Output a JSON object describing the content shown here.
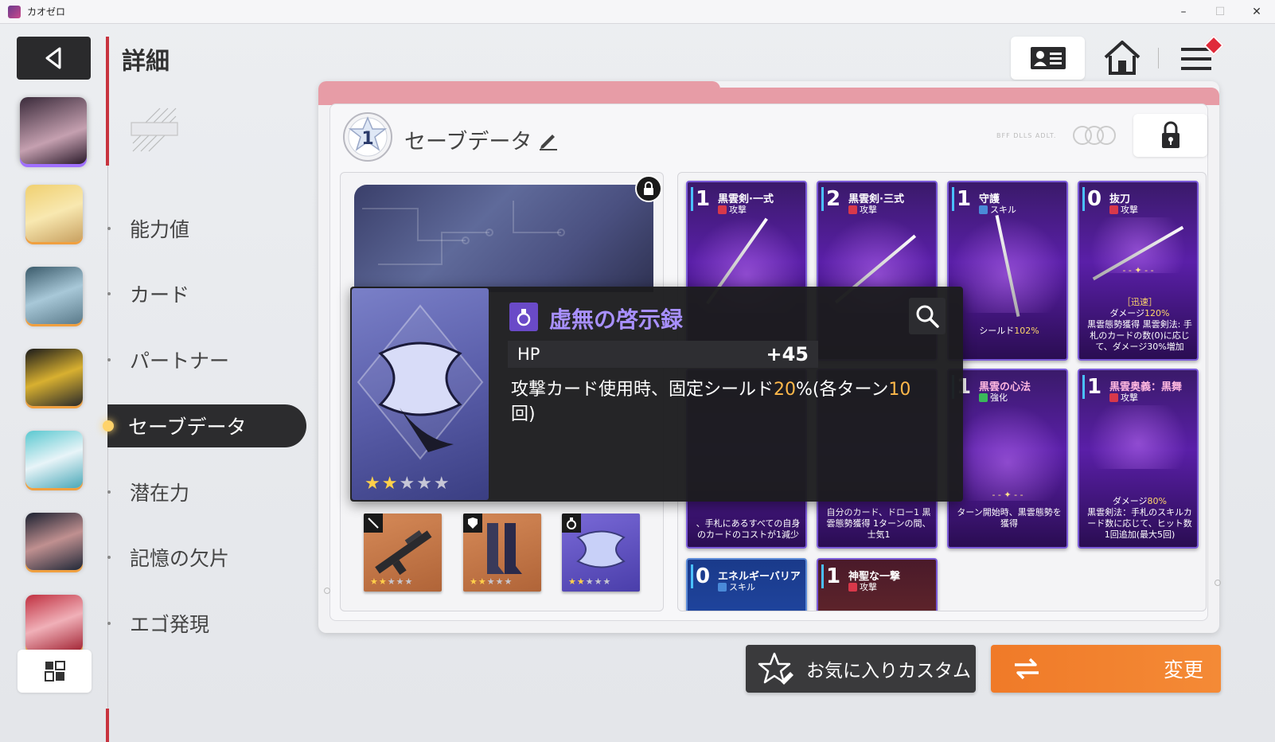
{
  "window": {
    "title": "カオゼロ",
    "min": "–",
    "max": "☐",
    "close": "✕"
  },
  "page": {
    "title": "詳細"
  },
  "menu": {
    "items": [
      {
        "label": "能力値"
      },
      {
        "label": "カード"
      },
      {
        "label": "パートナー"
      },
      {
        "label": "セーブデータ"
      },
      {
        "label": "潜在力"
      },
      {
        "label": "記憶の欠片"
      },
      {
        "label": "エゴ発現"
      }
    ],
    "active_index": 3
  },
  "save": {
    "slot_number": "1",
    "title": "セーブデータ",
    "faint_label": "BFF DLLS ADLT."
  },
  "equipment": [
    {
      "type": "weapon",
      "icon": "sword-icon",
      "stars": 2,
      "max_stars": 5
    },
    {
      "type": "armor",
      "icon": "armor-icon",
      "stars": 2,
      "max_stars": 5
    },
    {
      "type": "accessory",
      "icon": "ring-icon",
      "stars": 2,
      "max_stars": 5
    }
  ],
  "cards": [
    {
      "cost": "1",
      "name": "黒雲剣·一式",
      "type": "攻撃",
      "type_icon": "attack-icon",
      "desc": ""
    },
    {
      "cost": "2",
      "name": "黒雲剣·三式",
      "type": "攻撃",
      "type_icon": "attack-icon",
      "desc": ""
    },
    {
      "cost": "1",
      "name": "守護",
      "type": "スキル",
      "type_icon": "skill-icon",
      "desc_pre": "シールド",
      "desc_hl": "102%"
    },
    {
      "cost": "0",
      "name": "抜刀",
      "type": "攻撃",
      "type_icon": "attack-icon",
      "tag": "［迅速］",
      "desc_l1_pre": "ダメージ",
      "desc_l1_hl": "120%",
      "desc_rest": "黒雲態勢獲得 黒雲剣法: 手札のカードの数(0)に応じて、ダメージ30%増加",
      "desc_zero": "0"
    },
    {
      "cost": "",
      "name": "",
      "type": "",
      "desc": "、手札にあるすべての自身のカードのコストが1減少"
    },
    {
      "cost": "",
      "name": "",
      "type": "",
      "desc": "自分のカード、ドロー1 黒雲態勢獲得 1ターンの間、士気1"
    },
    {
      "cost": "1",
      "name": "黒雲の心法",
      "type": "強化",
      "type_icon": "boost-icon",
      "desc": "ターン開始時、黒雲態勢を獲得"
    },
    {
      "cost": "1",
      "name": "黒雲奥義：黒舞",
      "type": "攻撃",
      "type_icon": "attack-icon",
      "desc_l1_pre": "ダメージ",
      "desc_l1_hl": "80%",
      "desc_rest": "黒雲剣法：手札のスキルカード数に応じて、ヒット数1回追加(最大5回)"
    },
    {
      "cost": "0",
      "name": "エネルギーバリア",
      "type": "スキル",
      "type_icon": "skill-icon"
    },
    {
      "cost": "1",
      "name": "神聖な一撃",
      "type": "攻撃",
      "type_icon": "attack-icon"
    }
  ],
  "tooltip": {
    "category_icon": "ring-icon",
    "name": "虚無の啓示録",
    "stars": 2,
    "max_stars": 5,
    "stat_label": "HP",
    "stat_value": "+45",
    "effect_a": "攻撃カード使用時、固定シールド",
    "effect_hl1": "20",
    "effect_b": "%(各ターン",
    "effect_hl2": "10",
    "effect_c": "回)"
  },
  "buttons": {
    "favorite": "お気に入りカスタム",
    "change": "変更"
  },
  "colors": {
    "accent_red": "#c8333e",
    "change_orange": "#f07a28",
    "card_purple": "#5a1fa8",
    "tooltip_name": "#a890ff",
    "highlight": "#ffb84a"
  }
}
